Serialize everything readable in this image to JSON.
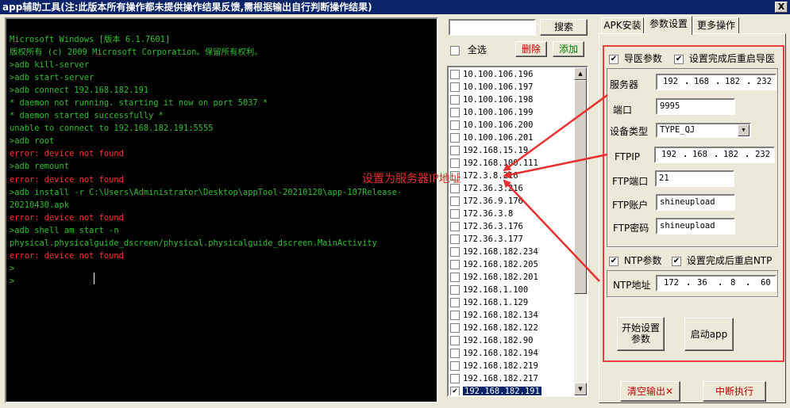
{
  "window": {
    "title": "app辅助工具(注:此版本所有操作都未提供操作结果反馈,需根据输出自行判断操作结果)",
    "close_label": "X"
  },
  "console": {
    "lines": [
      {
        "text": "Microsoft Windows [版本 6.1.7601]",
        "color": "green"
      },
      {
        "text": "版权所有 (c) 2009 Microsoft Corporation。保留所有权利。",
        "color": "green"
      },
      {
        "text": ">adb kill-server",
        "color": "green"
      },
      {
        "text": ">adb start-server",
        "color": "green"
      },
      {
        "text": ">adb connect 192.168.182.191",
        "color": "green"
      },
      {
        "text": "* daemon not running. starting it now on port 5037 *",
        "color": "green"
      },
      {
        "text": "* daemon started successfully *",
        "color": "green"
      },
      {
        "text": "unable to connect to 192.168.182.191:5555",
        "color": "green"
      },
      {
        "text": ">adb root",
        "color": "green"
      },
      {
        "text": "error: device not found",
        "color": "red"
      },
      {
        "text": ">adb remount",
        "color": "green"
      },
      {
        "text": "error: device not found",
        "color": "red"
      },
      {
        "text": ">adb install -r C:\\Users\\Administrator\\Desktop\\appTool-20210120\\app-107Release-",
        "color": "green"
      },
      {
        "text": "20210430.apk",
        "color": "green"
      },
      {
        "text": "error: device not found",
        "color": "red"
      },
      {
        "text": ">adb shell am start -n",
        "color": "green"
      },
      {
        "text": "physical.physicalguide_dscreen/physical.physicalguide_dscreen.MainActivity",
        "color": "green"
      },
      {
        "text": "error: device not found",
        "color": "red"
      },
      {
        "text": ">",
        "color": "green"
      },
      {
        "text": ">",
        "color": "green"
      }
    ]
  },
  "devices": {
    "search_value": "",
    "search_button": "搜索",
    "select_all_label": "全选",
    "select_all_checked": false,
    "delete_button": "删除",
    "add_button": "添加",
    "items": [
      {
        "ip": "10.100.106.196",
        "checked": false
      },
      {
        "ip": "10.100.106.197",
        "checked": false
      },
      {
        "ip": "10.100.106.198",
        "checked": false
      },
      {
        "ip": "10.100.106.199",
        "checked": false
      },
      {
        "ip": "10.100.106.200",
        "checked": false
      },
      {
        "ip": "10.100.106.201",
        "checked": false
      },
      {
        "ip": "192.168.15.19",
        "checked": false
      },
      {
        "ip": "192.168.100.111",
        "checked": false
      },
      {
        "ip": "172.3.8.216",
        "checked": false
      },
      {
        "ip": "172.36.3.216",
        "checked": false
      },
      {
        "ip": "172.36.9.176",
        "checked": false
      },
      {
        "ip": "172.36.3.8",
        "checked": false
      },
      {
        "ip": "172.36.3.176",
        "checked": false
      },
      {
        "ip": "172.36.3.177",
        "checked": false
      },
      {
        "ip": "192.168.182.234",
        "checked": false
      },
      {
        "ip": "192.168.182.205",
        "checked": false
      },
      {
        "ip": "192.168.182.201",
        "checked": false
      },
      {
        "ip": "192.168.1.100",
        "checked": false
      },
      {
        "ip": "192.168.1.129",
        "checked": false
      },
      {
        "ip": "192.168.182.134",
        "checked": false
      },
      {
        "ip": "192.168.182.122",
        "checked": false
      },
      {
        "ip": "192.168.182.90",
        "checked": false
      },
      {
        "ip": "192.168.182.194",
        "checked": false
      },
      {
        "ip": "192.168.182.219",
        "checked": false
      },
      {
        "ip": "192.168.182.217",
        "checked": false
      },
      {
        "ip": "192.168.182.191",
        "checked": true,
        "selected": true
      }
    ]
  },
  "tabs": [
    {
      "label": "APK安装",
      "active": false
    },
    {
      "label": "参数设置",
      "active": true
    },
    {
      "label": "更多操作",
      "active": false
    }
  ],
  "guide": {
    "enable_label": "导医参数",
    "enable_checked": true,
    "restart_label": "设置完成后重启导医",
    "restart_checked": true,
    "server_label": "服务器",
    "server_ip": [
      "192",
      "168",
      "182",
      "232"
    ],
    "port_label": "端口",
    "port_value": "9995",
    "device_type_label": "设备类型",
    "device_type_value": "TYPE_QJ",
    "ftp_ip_label": "FTPIP",
    "ftp_ip": [
      "192",
      "168",
      "182",
      "232"
    ],
    "ftp_port_label": "FTP端口",
    "ftp_port_value": "21",
    "ftp_user_label": "FTP账户",
    "ftp_user_value": "shineupload",
    "ftp_pass_label": "FTP密码",
    "ftp_pass_value": "shineupload"
  },
  "ntp": {
    "enable_label": "NTP参数",
    "enable_checked": true,
    "restart_label": "设置完成后重启NTP",
    "restart_checked": true,
    "address_label": "NTP地址",
    "address_ip": [
      "172",
      "36",
      "8",
      "60"
    ]
  },
  "actions": {
    "start_setup_line1": "开始设置",
    "start_setup_line2": "参数",
    "launch_app": "启动app",
    "clear_output": "清空输出✕",
    "abort": "中断执行"
  },
  "annotation": {
    "text": "设置为服务器IP地址",
    "color": "#e83030"
  },
  "colors": {
    "title_bar": "#0a246a",
    "console_green": "#2fbf2f",
    "console_error": "#ff3030",
    "highlight_box": "#e84040"
  }
}
